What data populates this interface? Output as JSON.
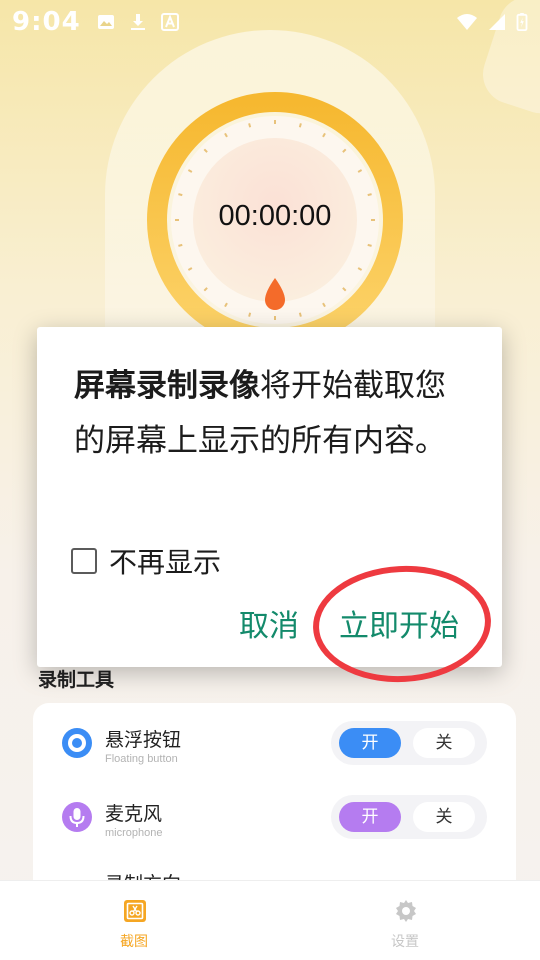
{
  "status_bar": {
    "time": "9:04"
  },
  "timer": {
    "display": "00:00:00"
  },
  "dialog": {
    "message_bold": "屏幕录制录像",
    "message_rest": "将开始截取您的屏幕上显示的所有内容。",
    "checkbox_label": "不再显示",
    "cancel_label": "取消",
    "start_label": "立即开始"
  },
  "tools": {
    "title": "录制工具",
    "items": [
      {
        "name": "悬浮按钮",
        "subtitle": "Floating button",
        "on_label": "开",
        "off_label": "关",
        "color": "#3b8df5"
      },
      {
        "name": "麦克风",
        "subtitle": "microphone",
        "on_label": "开",
        "off_label": "关",
        "color": "#b57cf0"
      },
      {
        "name": "录制方向"
      }
    ]
  },
  "nav": {
    "items": [
      {
        "label": "截图",
        "active": true,
        "color": "#f5a623"
      },
      {
        "label": "设置",
        "active": false,
        "color": "#c7c7c7"
      }
    ]
  },
  "colors": {
    "accent_green": "#138a6b",
    "annotation_red": "#ee3a40",
    "timer_ring": "#f8c440"
  },
  "icons": [
    "image-icon",
    "download-icon",
    "a-icon",
    "wifi-icon",
    "signal-icon",
    "battery-icon",
    "floating-button-icon",
    "microphone-icon",
    "screenshot-icon",
    "gear-icon"
  ]
}
